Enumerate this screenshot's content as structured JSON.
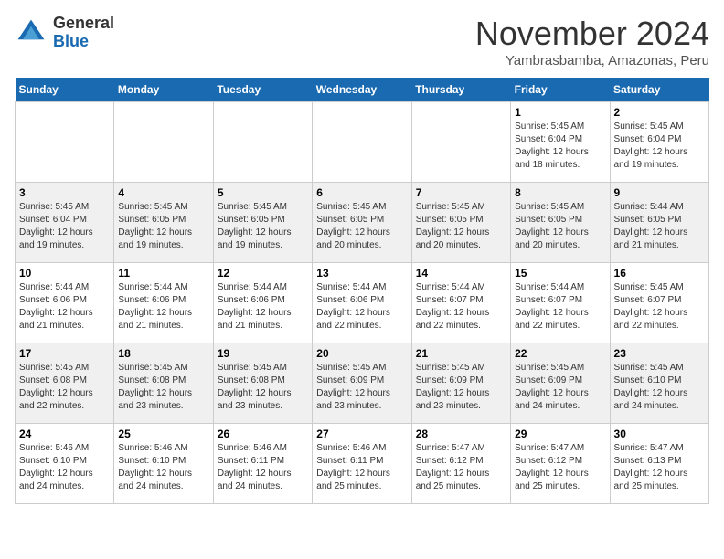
{
  "logo": {
    "general": "General",
    "blue": "Blue"
  },
  "title": "November 2024",
  "location": "Yambrasbamba, Amazonas, Peru",
  "weekdays": [
    "Sunday",
    "Monday",
    "Tuesday",
    "Wednesday",
    "Thursday",
    "Friday",
    "Saturday"
  ],
  "weeks": [
    [
      {
        "day": "",
        "sunrise": "",
        "sunset": "",
        "daylight": ""
      },
      {
        "day": "",
        "sunrise": "",
        "sunset": "",
        "daylight": ""
      },
      {
        "day": "",
        "sunrise": "",
        "sunset": "",
        "daylight": ""
      },
      {
        "day": "",
        "sunrise": "",
        "sunset": "",
        "daylight": ""
      },
      {
        "day": "",
        "sunrise": "",
        "sunset": "",
        "daylight": ""
      },
      {
        "day": "1",
        "sunrise": "Sunrise: 5:45 AM",
        "sunset": "Sunset: 6:04 PM",
        "daylight": "Daylight: 12 hours and 18 minutes."
      },
      {
        "day": "2",
        "sunrise": "Sunrise: 5:45 AM",
        "sunset": "Sunset: 6:04 PM",
        "daylight": "Daylight: 12 hours and 19 minutes."
      }
    ],
    [
      {
        "day": "3",
        "sunrise": "Sunrise: 5:45 AM",
        "sunset": "Sunset: 6:04 PM",
        "daylight": "Daylight: 12 hours and 19 minutes."
      },
      {
        "day": "4",
        "sunrise": "Sunrise: 5:45 AM",
        "sunset": "Sunset: 6:05 PM",
        "daylight": "Daylight: 12 hours and 19 minutes."
      },
      {
        "day": "5",
        "sunrise": "Sunrise: 5:45 AM",
        "sunset": "Sunset: 6:05 PM",
        "daylight": "Daylight: 12 hours and 19 minutes."
      },
      {
        "day": "6",
        "sunrise": "Sunrise: 5:45 AM",
        "sunset": "Sunset: 6:05 PM",
        "daylight": "Daylight: 12 hours and 20 minutes."
      },
      {
        "day": "7",
        "sunrise": "Sunrise: 5:45 AM",
        "sunset": "Sunset: 6:05 PM",
        "daylight": "Daylight: 12 hours and 20 minutes."
      },
      {
        "day": "8",
        "sunrise": "Sunrise: 5:45 AM",
        "sunset": "Sunset: 6:05 PM",
        "daylight": "Daylight: 12 hours and 20 minutes."
      },
      {
        "day": "9",
        "sunrise": "Sunrise: 5:44 AM",
        "sunset": "Sunset: 6:05 PM",
        "daylight": "Daylight: 12 hours and 21 minutes."
      }
    ],
    [
      {
        "day": "10",
        "sunrise": "Sunrise: 5:44 AM",
        "sunset": "Sunset: 6:06 PM",
        "daylight": "Daylight: 12 hours and 21 minutes."
      },
      {
        "day": "11",
        "sunrise": "Sunrise: 5:44 AM",
        "sunset": "Sunset: 6:06 PM",
        "daylight": "Daylight: 12 hours and 21 minutes."
      },
      {
        "day": "12",
        "sunrise": "Sunrise: 5:44 AM",
        "sunset": "Sunset: 6:06 PM",
        "daylight": "Daylight: 12 hours and 21 minutes."
      },
      {
        "day": "13",
        "sunrise": "Sunrise: 5:44 AM",
        "sunset": "Sunset: 6:06 PM",
        "daylight": "Daylight: 12 hours and 22 minutes."
      },
      {
        "day": "14",
        "sunrise": "Sunrise: 5:44 AM",
        "sunset": "Sunset: 6:07 PM",
        "daylight": "Daylight: 12 hours and 22 minutes."
      },
      {
        "day": "15",
        "sunrise": "Sunrise: 5:44 AM",
        "sunset": "Sunset: 6:07 PM",
        "daylight": "Daylight: 12 hours and 22 minutes."
      },
      {
        "day": "16",
        "sunrise": "Sunrise: 5:45 AM",
        "sunset": "Sunset: 6:07 PM",
        "daylight": "Daylight: 12 hours and 22 minutes."
      }
    ],
    [
      {
        "day": "17",
        "sunrise": "Sunrise: 5:45 AM",
        "sunset": "Sunset: 6:08 PM",
        "daylight": "Daylight: 12 hours and 22 minutes."
      },
      {
        "day": "18",
        "sunrise": "Sunrise: 5:45 AM",
        "sunset": "Sunset: 6:08 PM",
        "daylight": "Daylight: 12 hours and 23 minutes."
      },
      {
        "day": "19",
        "sunrise": "Sunrise: 5:45 AM",
        "sunset": "Sunset: 6:08 PM",
        "daylight": "Daylight: 12 hours and 23 minutes."
      },
      {
        "day": "20",
        "sunrise": "Sunrise: 5:45 AM",
        "sunset": "Sunset: 6:09 PM",
        "daylight": "Daylight: 12 hours and 23 minutes."
      },
      {
        "day": "21",
        "sunrise": "Sunrise: 5:45 AM",
        "sunset": "Sunset: 6:09 PM",
        "daylight": "Daylight: 12 hours and 23 minutes."
      },
      {
        "day": "22",
        "sunrise": "Sunrise: 5:45 AM",
        "sunset": "Sunset: 6:09 PM",
        "daylight": "Daylight: 12 hours and 24 minutes."
      },
      {
        "day": "23",
        "sunrise": "Sunrise: 5:45 AM",
        "sunset": "Sunset: 6:10 PM",
        "daylight": "Daylight: 12 hours and 24 minutes."
      }
    ],
    [
      {
        "day": "24",
        "sunrise": "Sunrise: 5:46 AM",
        "sunset": "Sunset: 6:10 PM",
        "daylight": "Daylight: 12 hours and 24 minutes."
      },
      {
        "day": "25",
        "sunrise": "Sunrise: 5:46 AM",
        "sunset": "Sunset: 6:10 PM",
        "daylight": "Daylight: 12 hours and 24 minutes."
      },
      {
        "day": "26",
        "sunrise": "Sunrise: 5:46 AM",
        "sunset": "Sunset: 6:11 PM",
        "daylight": "Daylight: 12 hours and 24 minutes."
      },
      {
        "day": "27",
        "sunrise": "Sunrise: 5:46 AM",
        "sunset": "Sunset: 6:11 PM",
        "daylight": "Daylight: 12 hours and 25 minutes."
      },
      {
        "day": "28",
        "sunrise": "Sunrise: 5:47 AM",
        "sunset": "Sunset: 6:12 PM",
        "daylight": "Daylight: 12 hours and 25 minutes."
      },
      {
        "day": "29",
        "sunrise": "Sunrise: 5:47 AM",
        "sunset": "Sunset: 6:12 PM",
        "daylight": "Daylight: 12 hours and 25 minutes."
      },
      {
        "day": "30",
        "sunrise": "Sunrise: 5:47 AM",
        "sunset": "Sunset: 6:13 PM",
        "daylight": "Daylight: 12 hours and 25 minutes."
      }
    ]
  ]
}
